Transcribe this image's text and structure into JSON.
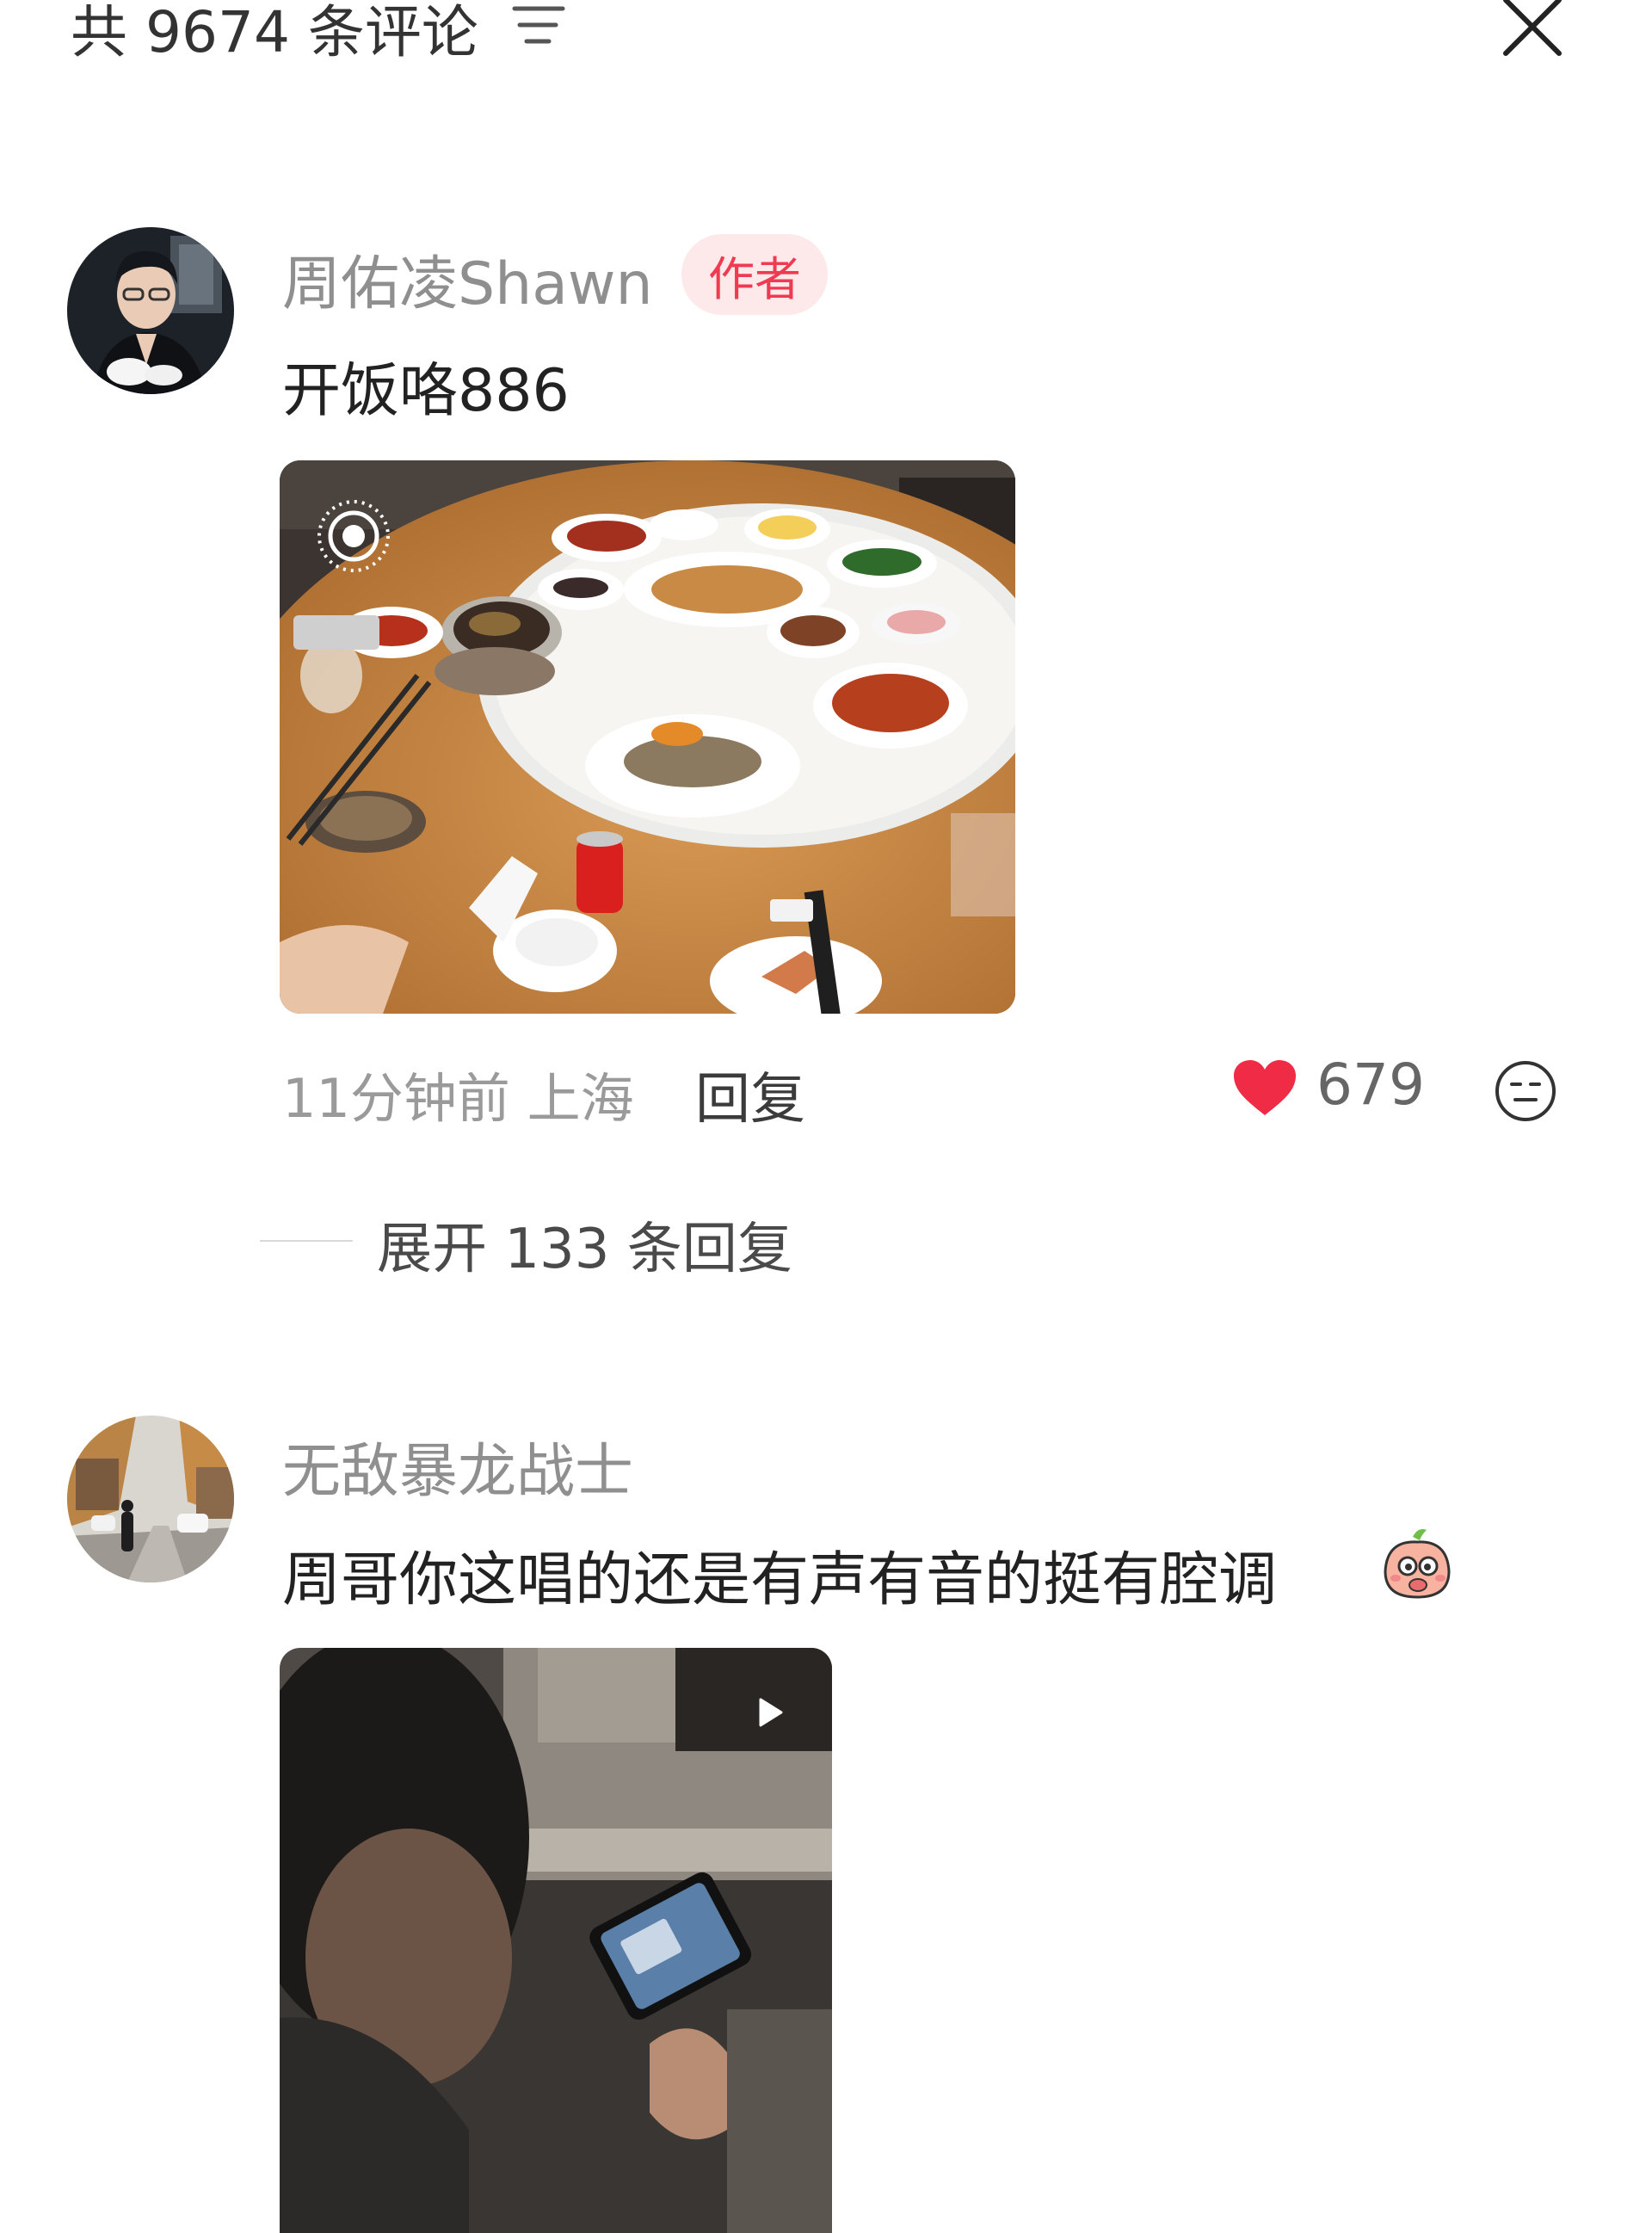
{
  "header": {
    "title": "共 9674 条评论",
    "filter_icon": "filter-lines-icon",
    "close_icon": "close-icon"
  },
  "comments": [
    {
      "username": "周佑凌Shawn",
      "badge": "作者",
      "text": "开饭咯886",
      "media": "photo-dinner-table",
      "live_icon": "live-photo-icon",
      "time_location": "11分钟前 上海",
      "reply_label": "回复",
      "like_icon": "heart-icon",
      "like_color": "#ef2b45",
      "likes": "679",
      "reaction_icon": "emoji-face-icon",
      "expand_label": "展开 133 条回复"
    },
    {
      "username": "无敌暴龙战士",
      "text": "周哥你这唱的还是有声有音的挺有腔调",
      "sticker_icon": "peach-sticker-icon",
      "media": "video-thumbnail",
      "play_icon": "play-icon"
    }
  ],
  "colors": {
    "badge_bg": "#fde8ea",
    "badge_text": "#ef3a52",
    "username": "#8f8f8f",
    "meta": "#9a9a9a"
  }
}
